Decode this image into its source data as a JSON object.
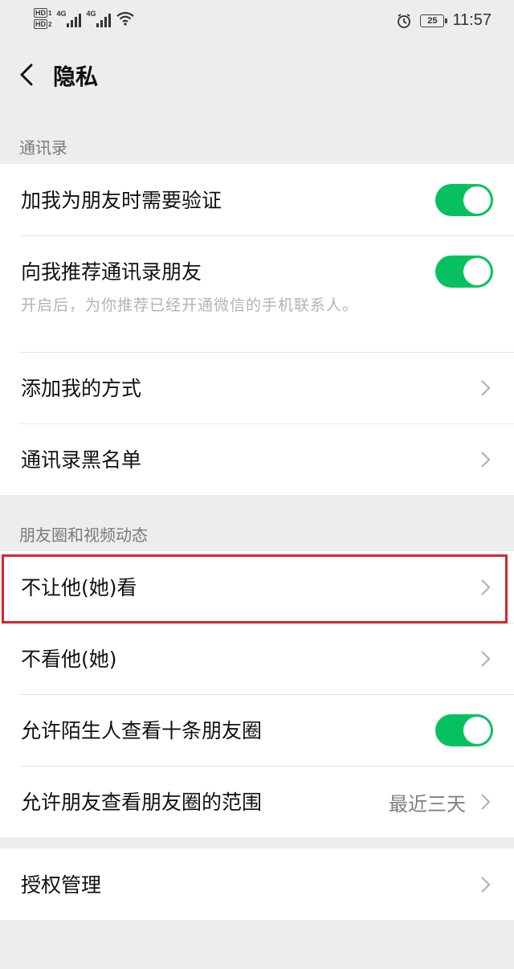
{
  "status_bar": {
    "hd1": "HD",
    "hd1_num": "1",
    "hd2": "HD",
    "hd2_num": "2",
    "signal1": "4G",
    "signal2": "4G",
    "battery": "25",
    "time": "11:57"
  },
  "header": {
    "title": "隐私"
  },
  "contacts_section": {
    "label": "通讯录",
    "items": [
      {
        "label": "加我为朋友时需要验证",
        "toggle": true
      },
      {
        "label": "向我推荐通讯录朋友",
        "sub": "开启后，为你推荐已经开通微信的手机联系人。",
        "toggle": true
      },
      {
        "label": "添加我的方式"
      },
      {
        "label": "通讯录黑名单"
      }
    ]
  },
  "moments_section": {
    "label": "朋友圈和视频动态",
    "items": [
      {
        "label": "不让他(她)看"
      },
      {
        "label": "不看他(她)"
      },
      {
        "label": "允许陌生人查看十条朋友圈",
        "toggle": true
      },
      {
        "label": "允许朋友查看朋友圈的范围",
        "value": "最近三天"
      }
    ]
  },
  "other_section": {
    "items": [
      {
        "label": "授权管理"
      }
    ]
  },
  "colors": {
    "accent": "#07c160",
    "highlight": "#d8242c",
    "background": "#ededed"
  }
}
